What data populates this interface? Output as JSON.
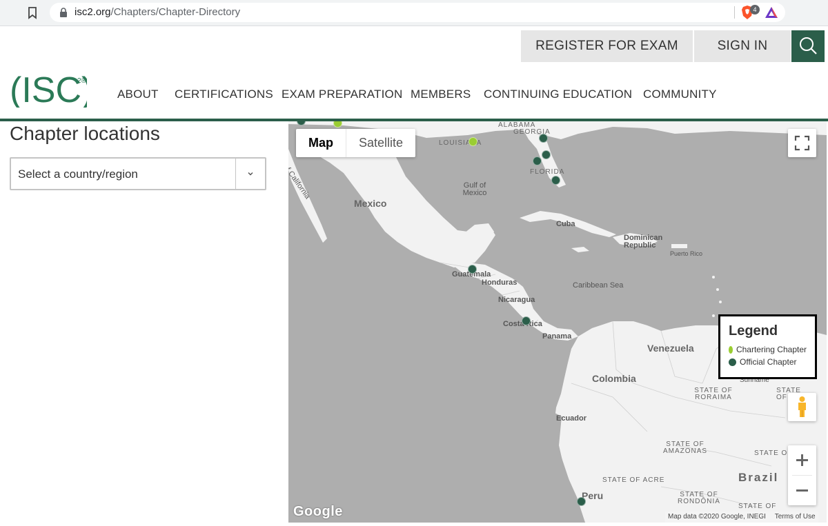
{
  "browser": {
    "url_host": "isc2.org",
    "url_path": "/Chapters/Chapter-Directory",
    "brave_badge": "4"
  },
  "header": {
    "logo_text": "(ISC)",
    "logo_superscript": "2®",
    "register_label": "REGISTER FOR EXAM",
    "signin_label": "SIGN IN",
    "nav": [
      {
        "label": "ABOUT"
      },
      {
        "label": "CERTIFICATIONS"
      },
      {
        "label": "EXAM PREPARATION"
      },
      {
        "label": "MEMBERS"
      },
      {
        "label": "CONTINUING EDUCATION"
      },
      {
        "label": "COMMUNITY"
      }
    ]
  },
  "sidebar": {
    "title": "Chapter locations",
    "select_value": "Select a country/region"
  },
  "map": {
    "type_buttons": [
      {
        "label": "Map",
        "active": true
      },
      {
        "label": "Satellite",
        "active": false
      }
    ],
    "labels": {
      "mexico": "Mexico",
      "gulf": "Gulf of Mexico",
      "cuba": "Cuba",
      "dominican_republic": "Dominican Republic",
      "puerto_rico": "Puerto Rico",
      "guatemala": "Guatemala",
      "honduras": "Honduras",
      "nicaragua": "Nicaragua",
      "costa_rica": "Costa Rica",
      "panama": "Panama",
      "caribbean": "Caribbean Sea",
      "venezuela": "Venezuela",
      "colombia": "Colombia",
      "ecuador": "Ecuador",
      "peru": "Peru",
      "brazil": "Brazil",
      "suriname": "Suriname",
      "georgia": "GEORGIA",
      "florida": "FLORIDA",
      "louisiana": "LOUISIANA",
      "alabama": "ALABAMA",
      "california": "of California",
      "roraima": "STATE OF RORAIMA",
      "amazonas": "STATE OF AMAZONAS",
      "acre": "STATE OF ACRE",
      "rondonia": "STATE OF RONDÔNIA",
      "state_am": "STATE OF AM",
      "state_o": "STATE O",
      "state_of": "STATE OF"
    },
    "legend": {
      "title": "Legend",
      "items": [
        {
          "label": "Chartering Chapter",
          "color": "#9acd32"
        },
        {
          "label": "Official Chapter",
          "color": "#2b5e4a"
        }
      ]
    },
    "google": "Google",
    "attribution": "Map data ©2020 Google, INEGI",
    "terms": "Terms of Use",
    "colors": {
      "chartering": "#9acd32",
      "official": "#2b5e4a"
    }
  }
}
